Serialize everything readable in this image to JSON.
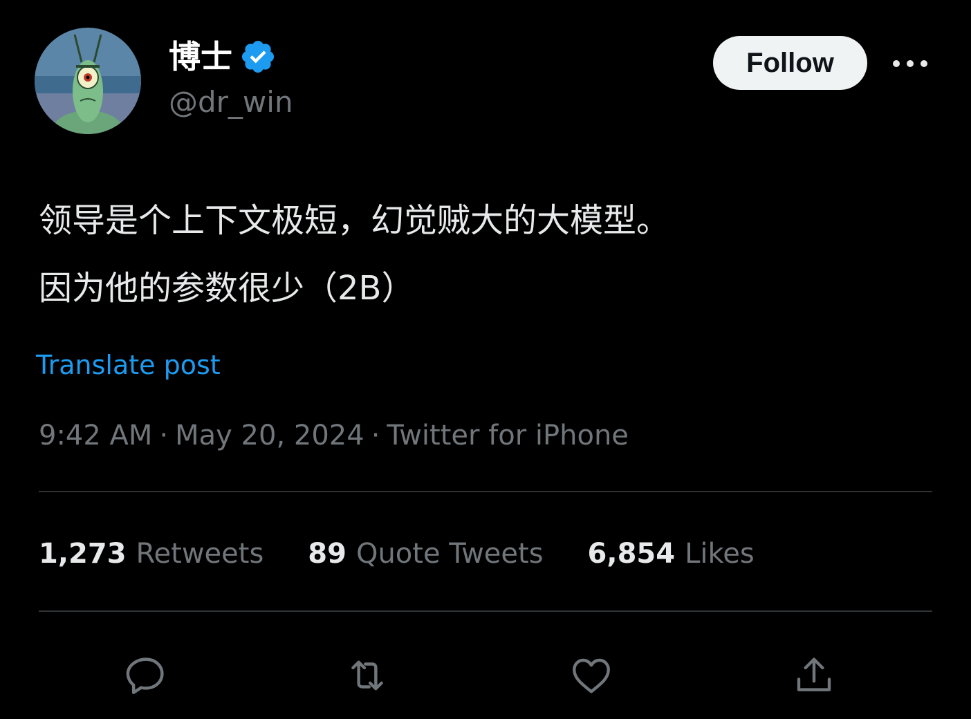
{
  "author": {
    "display_name": "博士",
    "handle": "@dr_win",
    "verified": true
  },
  "follow_button": {
    "label": "Follow"
  },
  "tweet": {
    "lines": [
      "领导是个上下文极短，幻觉贼大的大模型。",
      "因为他的参数很少（2B）"
    ]
  },
  "translate": {
    "label": "Translate post"
  },
  "meta": {
    "time": "9:42 AM",
    "separator": "·",
    "date": "May 20, 2024",
    "source": "Twitter for iPhone"
  },
  "stats": [
    {
      "number": "1,273",
      "label": "Retweets"
    },
    {
      "number": "89",
      "label": "Quote Tweets"
    },
    {
      "number": "6,854",
      "label": "Likes"
    }
  ],
  "actions": [
    "reply-icon",
    "retweet-icon",
    "like-icon",
    "share-icon"
  ],
  "colors": {
    "background": "#000000",
    "text": "#e7e9ea",
    "muted": "#71767b",
    "accent": "#1d9bf0",
    "divider": "#2f3336",
    "follow_bg": "#eff3f4"
  }
}
